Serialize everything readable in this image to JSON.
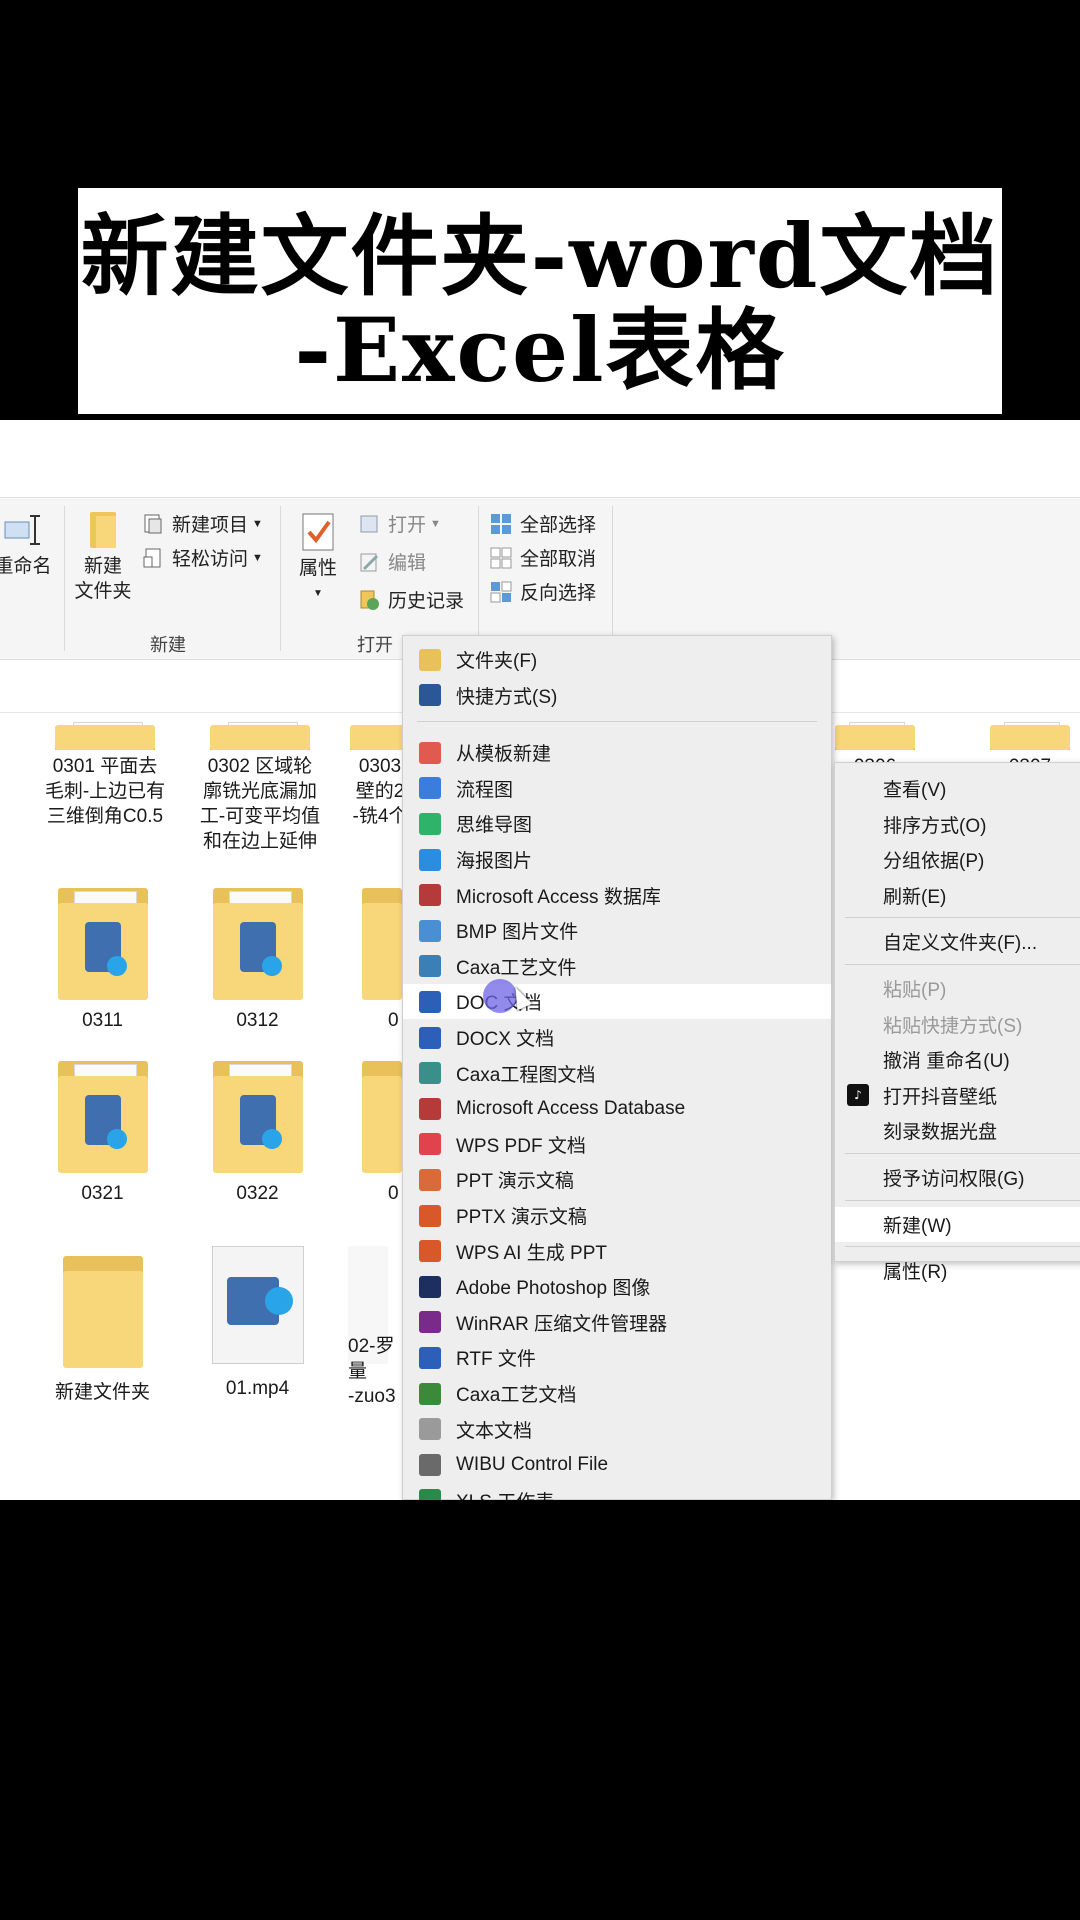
{
  "banner": {
    "line1": "新建文件夹-word文档",
    "line2": "-Excel表格"
  },
  "ribbon": {
    "rename_partial": "重命名",
    "new_item": "新建项目",
    "easy_access": "轻松访问",
    "new_folder_line1": "新建",
    "new_folder_line2": "文件夹",
    "group_new": "新建",
    "properties": "属性",
    "open": "打开",
    "edit": "编辑",
    "history": "历史记录",
    "group_open": "打开",
    "select_all": "全部选择",
    "select_none": "全部取消",
    "invert_select": "反向选择"
  },
  "files": [
    {
      "name": "0301 平面去\n毛刺-上边已有\n三维倒角C0.5"
    },
    {
      "name": "0302 区域轮\n廓铣光底漏加\n工-可变平均值\n和在边上延伸"
    },
    {
      "name": "0303\n壁的2\n-铣4个"
    },
    {
      "name": "0306"
    },
    {
      "name": "0307"
    },
    {
      "name": "0311"
    },
    {
      "name": "0312"
    },
    {
      "name": "0"
    },
    {
      "name": "0321"
    },
    {
      "name": "0322"
    },
    {
      "name": "0"
    },
    {
      "name": "新建文件夹"
    },
    {
      "name": "01.mp4"
    },
    {
      "name": "02-罗\n量\n-zuo3"
    }
  ],
  "new_submenu": {
    "items": [
      {
        "label": "文件夹(F)",
        "icon": "folder-icon",
        "color": "#e8c15a"
      },
      {
        "label": "快捷方式(S)",
        "icon": "shortcut-icon",
        "color": "#2b5797"
      },
      {
        "label": "从模板新建",
        "icon": "template-icon",
        "color": "#e05a4f"
      },
      {
        "label": "流程图",
        "icon": "flowchart-icon",
        "color": "#3b7ddd"
      },
      {
        "label": "思维导图",
        "icon": "mindmap-icon",
        "color": "#2fb36b"
      },
      {
        "label": "海报图片",
        "icon": "poster-icon",
        "color": "#2a8de0"
      },
      {
        "label": "Microsoft Access 数据库",
        "icon": "access-icon",
        "color": "#b53a3a"
      },
      {
        "label": "BMP 图片文件",
        "icon": "bmp-icon",
        "color": "#4a8fd4"
      },
      {
        "label": "Caxa工艺文件",
        "icon": "caxa-icon",
        "color": "#3a7fb5"
      },
      {
        "label": "DOC 文档",
        "icon": "doc-icon",
        "color": "#2b5fb8"
      },
      {
        "label": "DOCX 文档",
        "icon": "docx-icon",
        "color": "#2b5fb8"
      },
      {
        "label": "Caxa工程图文档",
        "icon": "caxa-drawing-icon",
        "color": "#3a8f8a"
      },
      {
        "label": "Microsoft Access Database",
        "icon": "access-db-icon",
        "color": "#b53a3a"
      },
      {
        "label": "WPS PDF 文档",
        "icon": "pdf-icon",
        "color": "#e0434c"
      },
      {
        "label": "PPT 演示文稿",
        "icon": "ppt-icon",
        "color": "#d96b3a"
      },
      {
        "label": "PPTX 演示文稿",
        "icon": "pptx-icon",
        "color": "#d9582a"
      },
      {
        "label": "WPS AI 生成 PPT",
        "icon": "wps-ai-ppt-icon",
        "color": "#d9582a"
      },
      {
        "label": "Adobe Photoshop 图像",
        "icon": "photoshop-icon",
        "color": "#1c2f5e"
      },
      {
        "label": "WinRAR 压缩文件管理器",
        "icon": "winrar-icon",
        "color": "#7a2a8a"
      },
      {
        "label": "RTF 文件",
        "icon": "rtf-icon",
        "color": "#2b5fb8"
      },
      {
        "label": "Caxa工艺文档",
        "icon": "caxa-doc-icon",
        "color": "#3a8a3a"
      },
      {
        "label": "文本文档",
        "icon": "text-doc-icon",
        "color": "#9a9a9a"
      },
      {
        "label": "WIBU Control File",
        "icon": "wibu-icon",
        "color": "#6a6a6a"
      },
      {
        "label": "XLS 工作表",
        "icon": "xls-icon",
        "color": "#2a8a4a"
      }
    ]
  },
  "context_menu": {
    "items": [
      {
        "label": "查看(V)"
      },
      {
        "label": "排序方式(O)"
      },
      {
        "label": "分组依据(P)"
      },
      {
        "label": "刷新(E)"
      },
      {
        "label": "自定义文件夹(F)..."
      },
      {
        "label": "粘贴(P)"
      },
      {
        "label": "粘贴快捷方式(S)"
      },
      {
        "label": "撤消 重命名(U)"
      },
      {
        "label": "打开抖音壁纸"
      },
      {
        "label": "刻录数据光盘"
      },
      {
        "label": "授予访问权限(G)"
      },
      {
        "label": "新建(W)"
      },
      {
        "label": "属性(R)"
      }
    ]
  }
}
